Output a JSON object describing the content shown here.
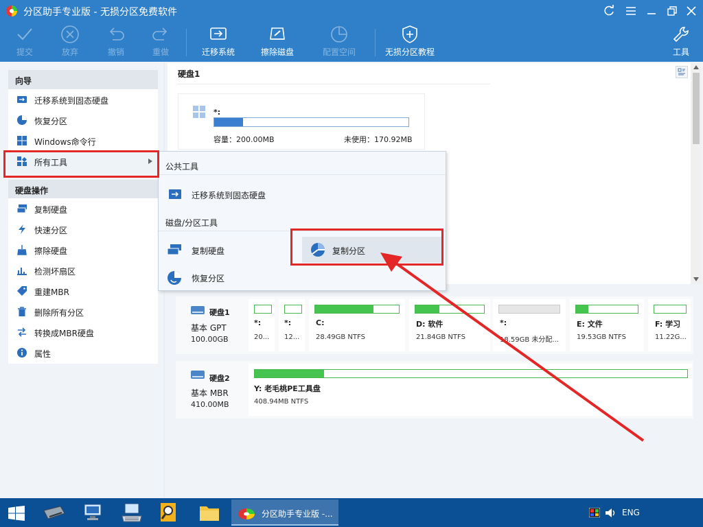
{
  "window": {
    "title": "分区助手专业版 - 无损分区免费软件"
  },
  "toolbar": {
    "commit": "提交",
    "discard": "放弃",
    "undo": "撤销",
    "redo": "重做",
    "migrate_os": "迁移系统",
    "wipe_disk": "擦除磁盘",
    "allocate_space": "配置空间",
    "tutorial": "无损分区教程",
    "tools": "工具"
  },
  "sidebar": {
    "wizard_header": "向导",
    "wizard_items": [
      {
        "label": "迁移系统到固态硬盘",
        "icon": "migrate-icon"
      },
      {
        "label": "恢复分区",
        "icon": "recover-icon"
      },
      {
        "label": "Windows命令行",
        "icon": "windows-icon"
      },
      {
        "label": "所有工具",
        "icon": "grid-icon"
      }
    ],
    "disk_ops_header": "硬盘操作",
    "disk_ops_items": [
      {
        "label": "复制硬盘",
        "icon": "copy-disk-icon"
      },
      {
        "label": "快速分区",
        "icon": "lightning-icon"
      },
      {
        "label": "擦除硬盘",
        "icon": "broom-icon"
      },
      {
        "label": "检测坏扇区",
        "icon": "scan-icon"
      },
      {
        "label": "重建MBR",
        "icon": "tag-icon"
      },
      {
        "label": "删除所有分区",
        "icon": "trash-icon"
      },
      {
        "label": "转换成MBR硬盘",
        "icon": "convert-icon"
      },
      {
        "label": "属性",
        "icon": "info-icon"
      }
    ]
  },
  "upper": {
    "disk_label": "硬盘1",
    "partition_name": "*:",
    "capacity": "容量：200.00MB",
    "unused": "未使用：170.92MB",
    "used_fraction": 0.15
  },
  "popup": {
    "public_tools": "公共工具",
    "migrate": "迁移系统到固态硬盘",
    "disk_partition_tools": "磁盘/分区工具",
    "copy_disk": "复制硬盘",
    "copy_partition": "复制分区",
    "recover_partition": "恢复分区"
  },
  "disk_map": {
    "disk1": {
      "name": "硬盘1",
      "type": "基本 GPT",
      "size": "100.00GB",
      "partitions": [
        {
          "name": "*:",
          "info": "20...",
          "fill": 0.0
        },
        {
          "name": "*:",
          "info": "12...",
          "fill": 0.0
        },
        {
          "name": "C:",
          "info": "28.49GB NTFS",
          "fill": 0.7
        },
        {
          "name": "D: 软件",
          "info": "21.84GB NTFS",
          "fill": 0.35
        },
        {
          "name": "*:",
          "info": "18.59GB 未分配...",
          "fill": 0.0
        },
        {
          "name": "E: 文件",
          "info": "19.53GB NTFS",
          "fill": 0.2
        },
        {
          "name": "F: 学习",
          "info": "11.22G...",
          "fill": 0.0
        }
      ]
    },
    "disk2": {
      "name": "硬盘2",
      "type": "基本 MBR",
      "size": "410.00MB",
      "partition_name": "Y: 老毛桃PE工具盘",
      "partition_info": "408.94MB NTFS",
      "fill": 0.16
    }
  },
  "taskbar": {
    "active_app": "分区助手专业版 -...",
    "lang": "ENG"
  }
}
